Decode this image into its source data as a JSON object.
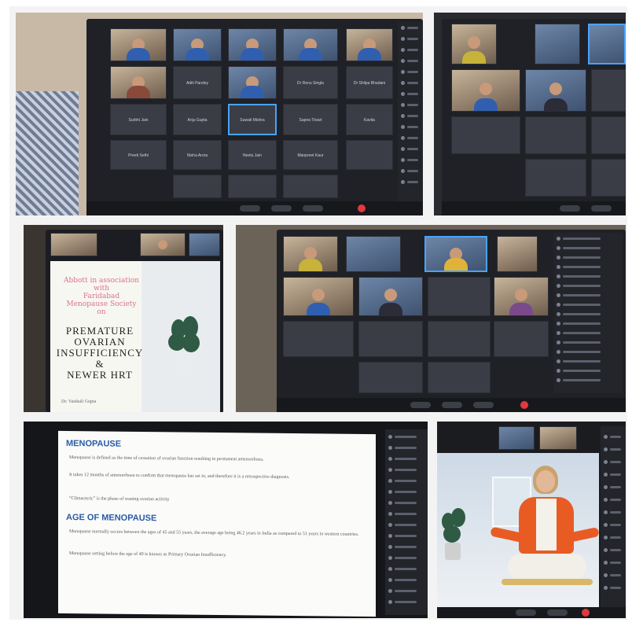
{
  "collage": {
    "photo1": {
      "participants": [
        "Aditi Pandey",
        "Dr Renu Singla",
        "Dr Shilpa Bhadani",
        "Surbhi Jain",
        "Anju Gupta",
        "Suwati Mishra",
        "Sapna Tiwari",
        "Kavita",
        "Preeti Sethi",
        "Nisha Arora",
        "Neetu Jain",
        "Manpreet Kaur"
      ]
    },
    "photo3": {
      "pink_line1": "Abbott in association",
      "pink_line2": "with",
      "pink_line3": "Faridabad",
      "pink_line4": "Menopause Society",
      "pink_line5": "on",
      "title_line1": "PREMATURE",
      "title_line2": "OVARIAN",
      "title_line3": "INSUFFICIENCY",
      "title_line4": "&",
      "title_line5": "NEWER HRT",
      "presenter": "Dr. Vaishali Gupta"
    },
    "photo5": {
      "heading1": "MENOPAUSE",
      "bullet1": "Menopause is defined as the time of cessation of ovarian function resulting in permanent amenorrhoea.",
      "bullet2": "It takes 12 months of amenorrhoea to confirm that menopause has set in, and therefore it is a retrospective diagnosis.",
      "bullet3": "“Climacteric” is the phase of waning ovarian activity",
      "heading2": "AGE OF MENOPAUSE",
      "bullet4": "Menopause normally occurs between the ages of 45 and 55 years, the average age being 46.2 years in India as compared to 51 years in western countries.",
      "bullet5": "Menopause setting before the age of 40 is known as Primary Ovarian Insufficiency."
    }
  },
  "colors": {
    "zoom_bg": "#1f2126",
    "tile": "#3a3d45",
    "active_border": "#4aa3ff",
    "leave_red": "#e0393e",
    "slide_heading": "#2a5ca8",
    "pink_text": "#d9748a",
    "jacket_orange": "#e85c24"
  }
}
